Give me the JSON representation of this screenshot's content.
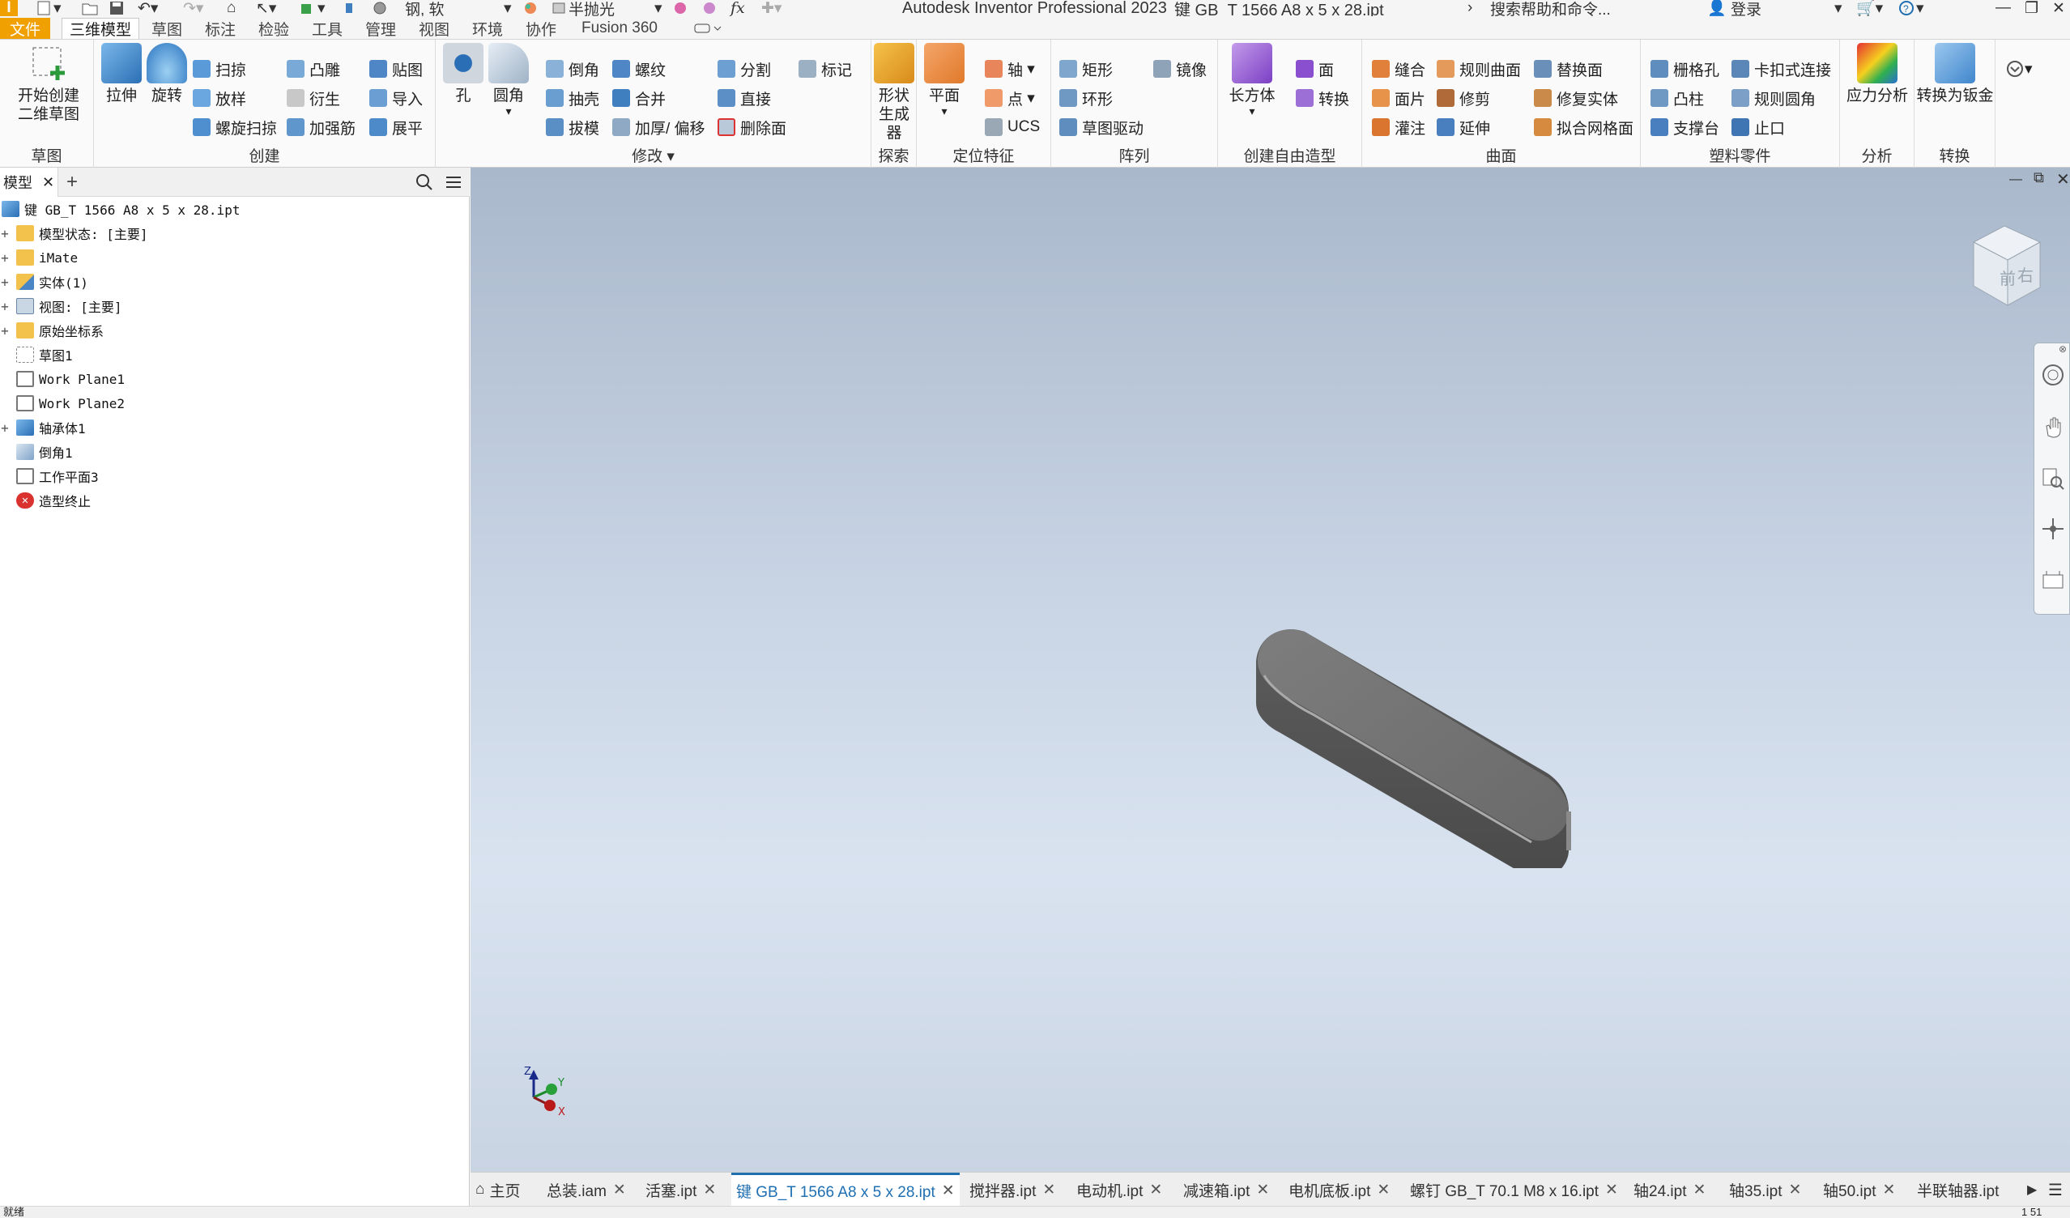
{
  "app": {
    "title": "Autodesk Inventor Professional 2023",
    "document": "键 GB_T 1566 A8 x 5 x 28.ipt",
    "material": "钢, 软",
    "appearance": "半抛光",
    "search_placeholder": "搜索帮助和命令...",
    "login": "登录"
  },
  "tabs": {
    "file": "文件",
    "items": [
      "三维模型",
      "草图",
      "标注",
      "检验",
      "工具",
      "管理",
      "视图",
      "环境",
      "协作",
      "Fusion 360"
    ],
    "active": "三维模型"
  },
  "ribbon": {
    "sketch": {
      "title": "草图",
      "start_line1": "开始创建",
      "start_line2": "二维草图"
    },
    "create": {
      "title": "创建",
      "extrude": "拉伸",
      "revolve": "旋转",
      "sweep": "扫掠",
      "loft": "放样",
      "coil": "螺旋扫掠",
      "emboss": "凸雕",
      "derive": "衍生",
      "rib": "加强筋",
      "decal": "贴图",
      "import": "导入",
      "unfold": "展平"
    },
    "modify": {
      "title": "修改",
      "hole": "孔",
      "fillet": "圆角",
      "chamfer": "倒角",
      "shell": "抽壳",
      "draft": "拔模",
      "thread": "螺纹",
      "combine": "合并",
      "thicken": "加厚/ 偏移",
      "split": "分割",
      "direct": "直接",
      "delete_face": "删除面",
      "mark": "标记"
    },
    "explore": {
      "title": "探索",
      "generator_line1": "形状",
      "generator_line2": "生成器"
    },
    "work": {
      "title": "定位特征",
      "plane": "平面",
      "axis": "轴",
      "point": "点",
      "ucs": "UCS"
    },
    "pattern": {
      "title": "阵列",
      "rect": "矩形",
      "circ": "环形",
      "sketch_driven": "草图驱动",
      "mirror": "镜像"
    },
    "freeform": {
      "title": "创建自由造型",
      "box": "长方体",
      "face": "面",
      "convert": "转换"
    },
    "surface": {
      "title": "曲面",
      "stitch": "缝合",
      "ruled": "规则曲面",
      "replace": "替换面",
      "patch": "面片",
      "trim": "修剪",
      "repair": "修复实体",
      "sculpt": "灌注",
      "extend": "延伸",
      "fit_mesh": "拟合网格面"
    },
    "plastic": {
      "title": "塑料零件",
      "grill": "栅格孔",
      "snap_fit": "卡扣式连接",
      "boss": "凸柱",
      "rule_fillet": "规则圆角",
      "rest": "支撑台",
      "lip": "止口"
    },
    "analysis": {
      "title": "分析",
      "stress": "应力分析"
    },
    "convert": {
      "title": "转换",
      "sheet_metal": "转换为钣金"
    }
  },
  "browser": {
    "tab": "模型",
    "root": "键 GB_T 1566 A8 x 5 x 28.ipt",
    "nodes": [
      "模型状态: [主要]",
      "iMate",
      "实体(1)",
      "视图: [主要]",
      "原始坐标系",
      "草图1",
      "Work Plane1",
      "Work Plane2",
      "轴承体1",
      "倒角1",
      "工作平面3",
      "造型终止"
    ]
  },
  "viewcube": {
    "front": "前",
    "right": "右"
  },
  "triad": {
    "x": "X",
    "y": "Y",
    "z": "Z"
  },
  "doc_tabs": {
    "home": "主页",
    "items": [
      "总装.iam",
      "活塞.ipt",
      "键 GB_T 1566 A8 x 5 x 28.ipt",
      "搅拌器.ipt",
      "电动机.ipt",
      "减速箱.ipt",
      "电机底板.ipt",
      "螺钉 GB_T 70.1 M8 x 16.ipt",
      "轴24.ipt",
      "轴35.ipt",
      "轴50.ipt",
      "半联轴器.ipt"
    ],
    "active_index": 2
  },
  "status": {
    "left": "就绪",
    "right": "1 51"
  },
  "colors": {
    "accent": "#f0a000",
    "active_tab": "#1f6fb3",
    "viewport_top": "#aab8cc",
    "viewport_bottom": "#d9e3f0",
    "part": "#6e6e6e"
  }
}
